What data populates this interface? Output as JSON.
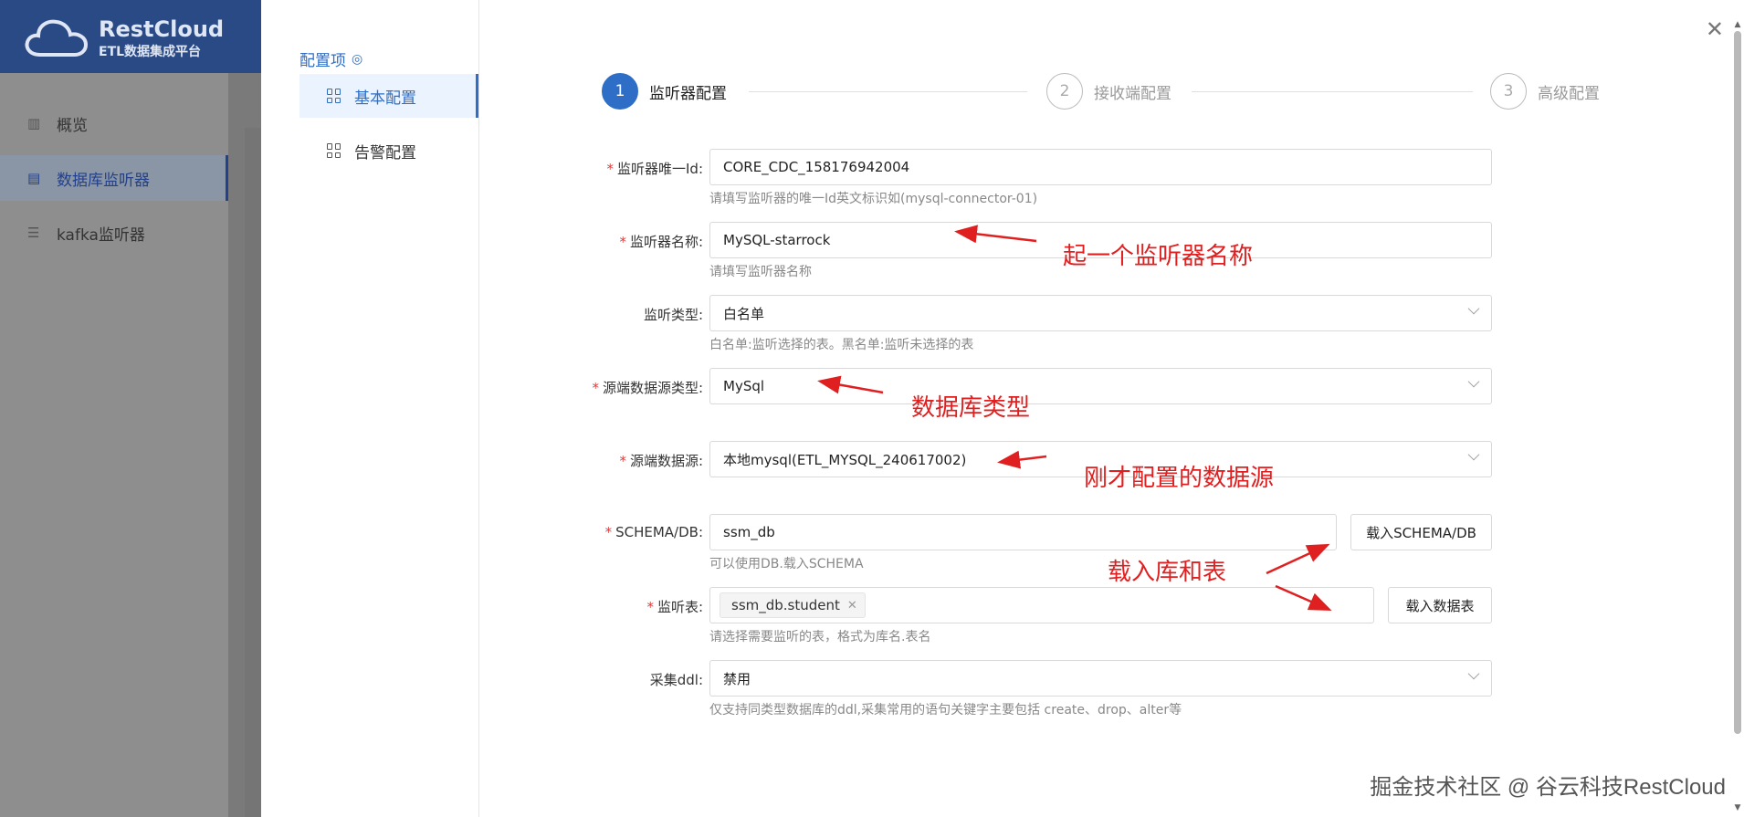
{
  "app": {
    "brand": "RestCloud",
    "subtitle": "ETL数据集成平台",
    "nav": [
      {
        "label": "概览",
        "icon": "bar-chart-icon"
      },
      {
        "label": "数据库监听器",
        "icon": "document-icon"
      },
      {
        "label": "kafka监听器",
        "icon": "list-icon"
      }
    ]
  },
  "drawer": {
    "side_title": "配置项",
    "side_items": [
      {
        "label": "基本配置",
        "active": true
      },
      {
        "label": "告警配置",
        "active": false
      }
    ],
    "steps": [
      {
        "num": "1",
        "label": "监听器配置"
      },
      {
        "num": "2",
        "label": "接收端配置"
      },
      {
        "num": "3",
        "label": "高级配置"
      }
    ],
    "form": {
      "listener_id": {
        "label": "监听器唯一Id:",
        "value": "CORE_CDC_158176942004",
        "help": "请填写监听器的唯一Id英文标识如(mysql-connector-01)"
      },
      "listener_name": {
        "label": "监听器名称:",
        "value": "MySQL-starrock",
        "help": "请填写监听器名称"
      },
      "listen_type": {
        "label": "监听类型:",
        "value": "白名单",
        "help": "白名单:监听选择的表。黑名单:监听未选择的表"
      },
      "source_type": {
        "label": "源端数据源类型:",
        "value": "MySql"
      },
      "source": {
        "label": "源端数据源:",
        "value": "本地mysql(ETL_MYSQL_240617002)"
      },
      "schema": {
        "label": "SCHEMA/DB:",
        "value": "ssm_db",
        "help": "可以使用DB.载入SCHEMA",
        "button": "载入SCHEMA/DB"
      },
      "tables": {
        "label": "监听表:",
        "tag": "ssm_db.student",
        "help": "请选择需要监听的表，格式为库名.表名",
        "button": "载入数据表"
      },
      "ddl": {
        "label": "采集ddl:",
        "value": "禁用",
        "help": "仅支持同类型数据库的ddl,采集常用的语句关键字主要包括 create、drop、alter等"
      }
    }
  },
  "annotations": {
    "name": "起一个监听器名称",
    "dbtype": "数据库类型",
    "source": "刚才配置的数据源",
    "load": "载入库和表"
  },
  "watermark": "掘金技术社区 @ 谷云科技RestCloud",
  "colors": {
    "accent": "#2f6ec7",
    "annotation": "#e02020",
    "header": "#2a4a86"
  }
}
